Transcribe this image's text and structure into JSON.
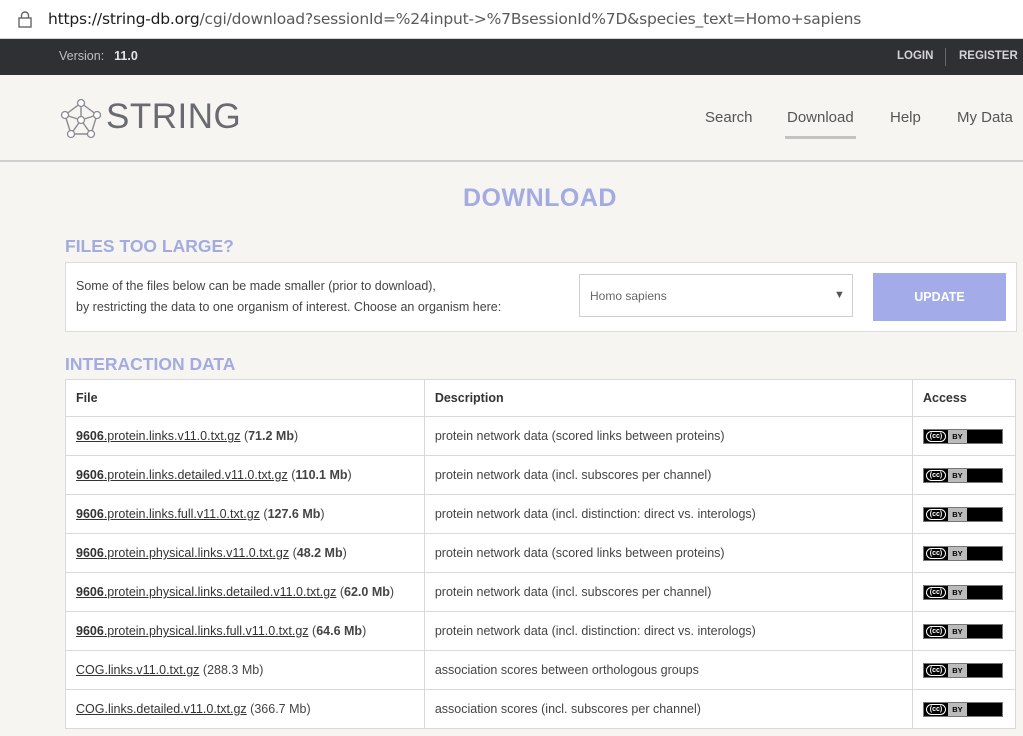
{
  "browser": {
    "url_host": "https://string-db.org",
    "url_path": "/cgi/download?sessionId=%24input->%7BsessionId%7D&species_text=Homo+sapiens"
  },
  "topbar": {
    "version_label": "Version:",
    "version_value": "11.0",
    "login": "LOGIN",
    "register": "REGISTER"
  },
  "header": {
    "logo_text": "STRING",
    "nav": {
      "search": "Search",
      "download": "Download",
      "help": "Help",
      "mydata": "My Data"
    }
  },
  "page": {
    "title": "DOWNLOAD",
    "files_too_large": "FILES TOO LARGE?",
    "filter_text_1": "Some of the files below can be made smaller (prior to download),",
    "filter_text_2": "by restricting the data to one organism of interest. Choose an organism here:",
    "organism_selected": "Homo sapiens",
    "update_button": "UPDATE",
    "interaction_data": "INTERACTION DATA"
  },
  "table": {
    "headers": {
      "file": "File",
      "description": "Description",
      "access": "Access"
    },
    "rows": [
      {
        "prefix": "9606",
        "name": ".protein.links.v11.0.txt.gz",
        "size": "71.2 Mb",
        "desc": "protein network data (scored links between proteins)"
      },
      {
        "prefix": "9606",
        "name": ".protein.links.detailed.v11.0.txt.gz",
        "size": "110.1 Mb",
        "desc": "protein network data (incl. subscores per channel)"
      },
      {
        "prefix": "9606",
        "name": ".protein.links.full.v11.0.txt.gz",
        "size": "127.6 Mb",
        "desc": "protein network data (incl. distinction: direct vs. interologs)"
      },
      {
        "prefix": "9606",
        "name": ".protein.physical.links.v11.0.txt.gz",
        "size": "48.2 Mb",
        "desc": "protein network data (scored links between proteins)"
      },
      {
        "prefix": "9606",
        "name": ".protein.physical.links.detailed.v11.0.txt.gz",
        "size": "62.0 Mb",
        "desc": "protein network data (incl. subscores per channel)"
      },
      {
        "prefix": "9606",
        "name": ".protein.physical.links.full.v11.0.txt.gz",
        "size": "64.6 Mb",
        "desc": "protein network data (incl. distinction: direct vs. interologs)"
      },
      {
        "prefix": "",
        "name": "COG.links.v11.0.txt.gz",
        "size": "288.3 Mb",
        "desc": "association scores between orthologous groups"
      },
      {
        "prefix": "",
        "name": "COG.links.detailed.v11.0.txt.gz",
        "size": "366.7 Mb",
        "desc": "association scores (incl. subscores per channel)"
      }
    ]
  },
  "license": {
    "cc": "(cc)",
    "by": "BY"
  }
}
